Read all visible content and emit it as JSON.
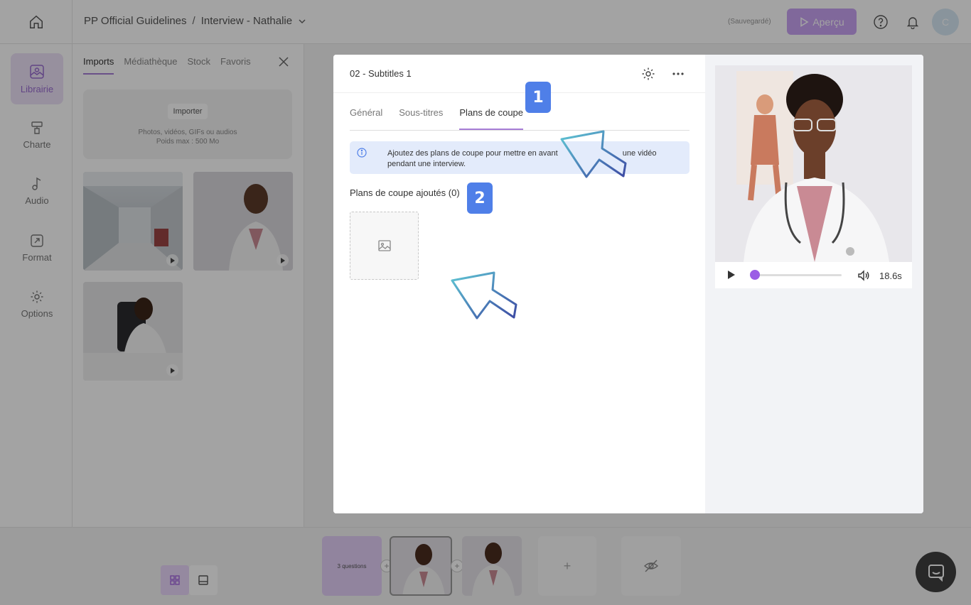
{
  "header": {
    "project": "PP Official Guidelines",
    "separator": "/",
    "video": "Interview - Nathalie",
    "saved_status": "(Sauvegardé)",
    "preview_label": "Aperçu",
    "avatar_initial": "C"
  },
  "leftnav": {
    "items": [
      {
        "label": "Librairie",
        "icon": "image-icon"
      },
      {
        "label": "Charte",
        "icon": "paint-roller-icon"
      },
      {
        "label": "Audio",
        "icon": "music-note-icon"
      },
      {
        "label": "Format",
        "icon": "resize-icon"
      },
      {
        "label": "Options",
        "icon": "gear-icon"
      }
    ]
  },
  "library": {
    "tabs": [
      "Imports",
      "Médiathèque",
      "Stock",
      "Favoris"
    ],
    "active_tab": "Imports",
    "import_button": "Importer",
    "import_help_line1": "Photos, vidéos, GIFs ou audios",
    "import_help_line2": "Poids max : 500 Mo"
  },
  "timeline": {
    "questions_label": "3 questions",
    "add_label": "+"
  },
  "modal": {
    "title": "02 - Subtitles 1",
    "tabs": [
      "Général",
      "Sous-titres",
      "Plans de coupe"
    ],
    "active_tab": "Plans de coupe",
    "info_text_line1": "Ajoutez des plans de coupe pour mettre en avant",
    "info_text_line1_end": "une vidéo",
    "info_text_line2": "pendant une interview.",
    "section_title": "Plans de coupe ajoutés (0)",
    "step1": "1",
    "step2": "2"
  },
  "player": {
    "duration": "18.6s",
    "progress": 0.05
  },
  "colors": {
    "accent": "#a77dd6",
    "preview_button": "#c9a3f2",
    "step_badge": "#4f7fe8",
    "info_bg": "#e3ebfb",
    "progress": "#9b5de5"
  }
}
